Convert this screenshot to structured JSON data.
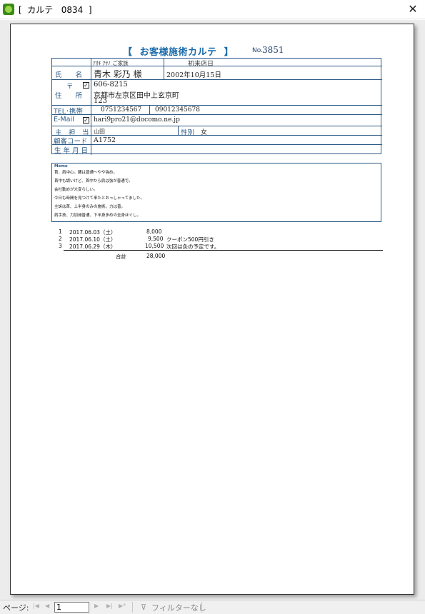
{
  "window": {
    "title": "[  カルテ   0834  ]",
    "icon": "app-leaf-icon",
    "close_glyph": "✕"
  },
  "report": {
    "title": "【  お客様施術カルテ  】",
    "no_label": "No.",
    "no_value": "3851"
  },
  "info": {
    "name_label": "氏　　名",
    "furigana": "ｱｵｷ ｱﾔﾉ ご家族",
    "name_value": "青木 彩乃 様",
    "first_visit_label": "初来店日",
    "first_visit_value": "2002年10月15日",
    "postal_label": "〒",
    "postal_checked": true,
    "postal_value": "606-8215",
    "address_label": "住　　所",
    "address_line1": "京都市左京区田中上玄京町",
    "address_line2": "123",
    "tel_label": "TEL･携帯",
    "tel_value": "0751234567",
    "mobile_value": "09012345678",
    "email_label": "E-Mail",
    "email_checked": true,
    "email_value": "hari9pro21@docomo.ne.jp",
    "staff_label": "主　担　当",
    "staff_value": "山田",
    "gender_label": "性別",
    "gender_value": "女",
    "code_label": "顧客コード",
    "code_value": "A1752",
    "birth_label": "生 年 月 日",
    "birth_value": ""
  },
  "memo": {
    "label": "Memo",
    "lines": [
      "首、肩中心。腰は普通～やや強め。",
      "首中も調いけど、首中から肩は強が普通で。",
      "会社勤めが大変らしい。",
      "今日も時間を見つけて来たとおっしゃってました。",
      "主訴は首、上半身のみの施術。力は普。",
      "肩手技、力加減普通、下半身多めの全身ほぐし。"
    ]
  },
  "visits": [
    {
      "no": "1",
      "date": "2017.06.03（土）",
      "amount": "8,000",
      "note": ""
    },
    {
      "no": "2",
      "date": "2017.06.10（土）",
      "amount": "9,500",
      "note": "クーポン500円引き"
    },
    {
      "no": "3",
      "date": "2017.06.29（木）",
      "amount": "10,500",
      "note": "次回は灸の予定です。"
    }
  ],
  "total": {
    "label": "合計",
    "value": "28,000"
  },
  "navbar": {
    "page_label": "ページ:",
    "page_value": "1",
    "first_icon": "first-page-icon",
    "prev_icon": "prev-page-icon",
    "next_icon": "next-page-icon",
    "last_icon": "last-page-icon",
    "new_icon": "new-record-icon",
    "filter_label": "フィルターなし"
  }
}
